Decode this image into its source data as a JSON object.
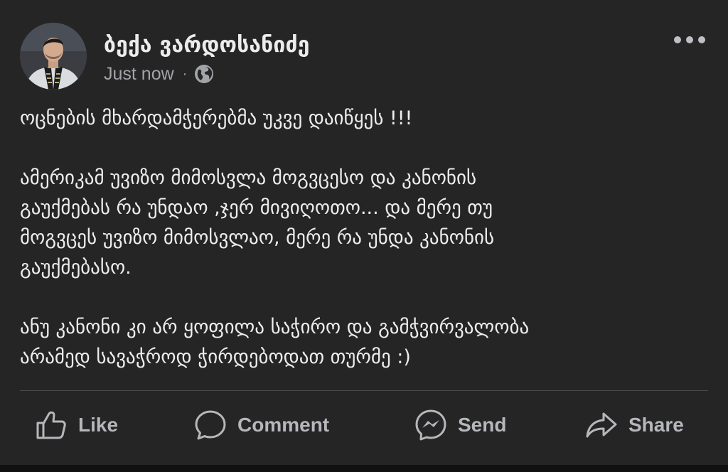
{
  "author": {
    "name": "ბექა ვარდოსანიძე"
  },
  "meta": {
    "timestamp": "Just now",
    "separator": "·",
    "audience_icon": "globe-icon"
  },
  "more_icon": "more-options-icon",
  "post": {
    "paragraphs": [
      [
        "ოცნების მხარდამჭერებმა უკვე დაიწყეს !!!"
      ],
      [
        "ამერიკამ უვიზო მიმოსვლა მოგვცესო და კანონის",
        "გაუქმებას რა უნდაო ,ჯერ მივიღოთო... და მერე თუ",
        "მოგვცეს უვიზო მიმოსვლაო, მერე რა უნდა კანონის",
        "გაუქმებასო."
      ],
      [
        "ანუ კანონი კი არ ყოფილა საჭირო და გამჭვირვალობა",
        "არამედ სავაჭროდ ჭირდებოდათ თურმე :)"
      ]
    ]
  },
  "actions": {
    "like": {
      "label": "Like",
      "icon": "thumbs-up-icon"
    },
    "comment": {
      "label": "Comment",
      "icon": "comment-bubble-icon"
    },
    "send": {
      "label": "Send",
      "icon": "messenger-icon"
    },
    "share": {
      "label": "Share",
      "icon": "share-arrow-icon"
    }
  },
  "colors": {
    "background": "#252526",
    "text": "#ededed",
    "muted": "#a3a4a8",
    "action": "#b6b7bb",
    "divider": "#4a4b4f"
  }
}
